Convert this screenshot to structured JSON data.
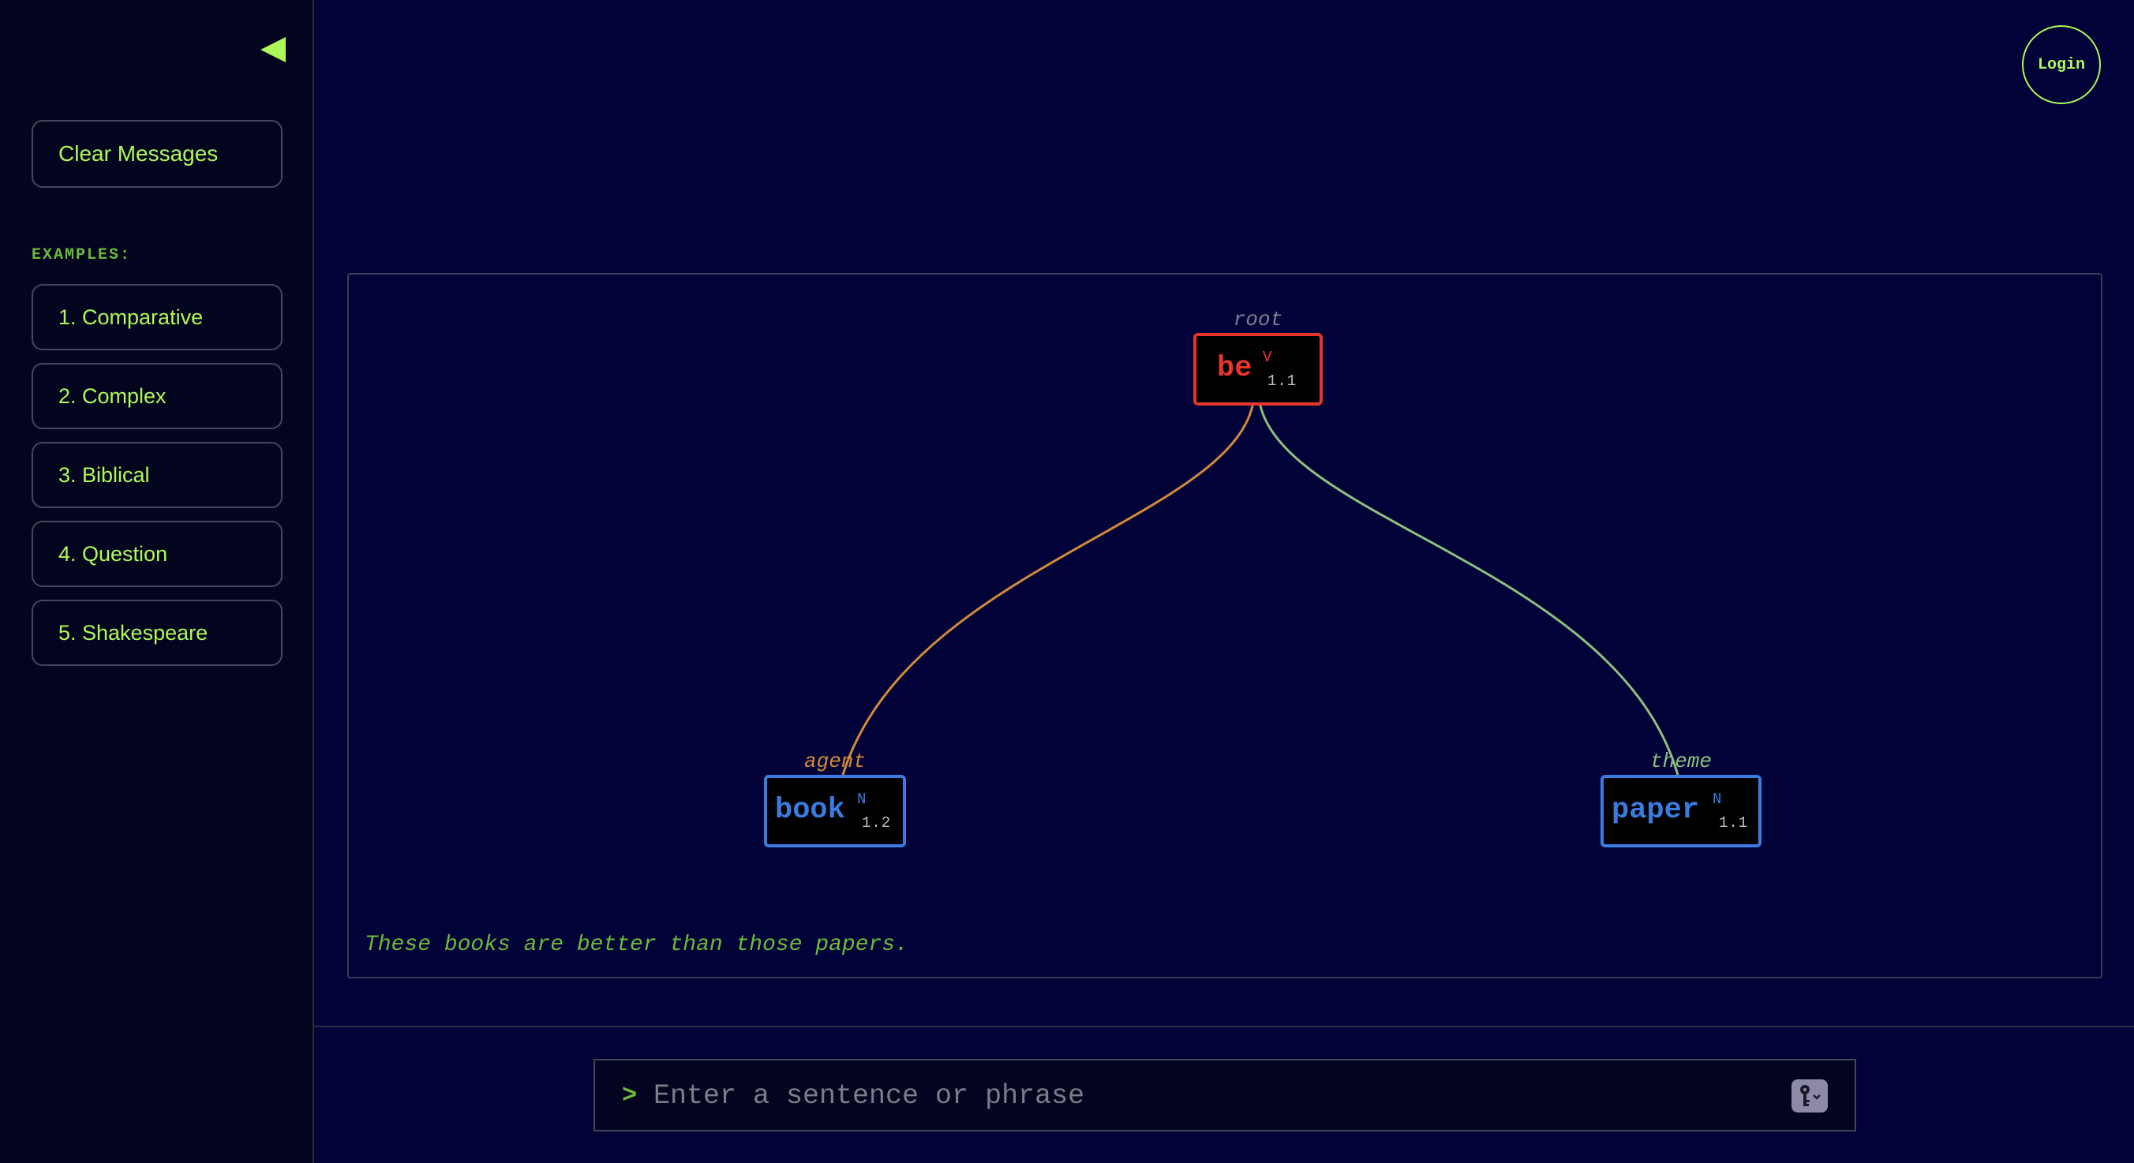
{
  "sidebar": {
    "collapse_icon": "triangle-left-icon",
    "clear_label": "Clear Messages",
    "examples_heading": "EXAMPLES:",
    "examples": [
      {
        "label": "1. Comparative"
      },
      {
        "label": "2. Complex"
      },
      {
        "label": "3. Biblical"
      },
      {
        "label": "4. Question"
      },
      {
        "label": "5. Shakespeare"
      }
    ]
  },
  "header": {
    "login_label": "Login"
  },
  "graph": {
    "root_label": "root",
    "nodes": [
      {
        "word": "be",
        "pos": "V",
        "sense": "1.1",
        "color": "#e8352a"
      },
      {
        "word": "book",
        "pos": "N",
        "sense": "1.2",
        "color": "#3b7be0"
      },
      {
        "word": "paper",
        "pos": "N",
        "sense": "1.1",
        "color": "#3b7be0"
      }
    ],
    "edges": [
      {
        "label": "agent",
        "color": "#d28a3a"
      },
      {
        "label": "theme",
        "color": "#8cc07e"
      }
    ],
    "sentence": "These books are better than those papers."
  },
  "input": {
    "prompt": ">",
    "placeholder": "Enter a sentence or phrase",
    "key_icon": "key-icon"
  },
  "colors": {
    "accent": "#aef95a",
    "background": "#010237",
    "sidebar_bg": "#03051e"
  }
}
